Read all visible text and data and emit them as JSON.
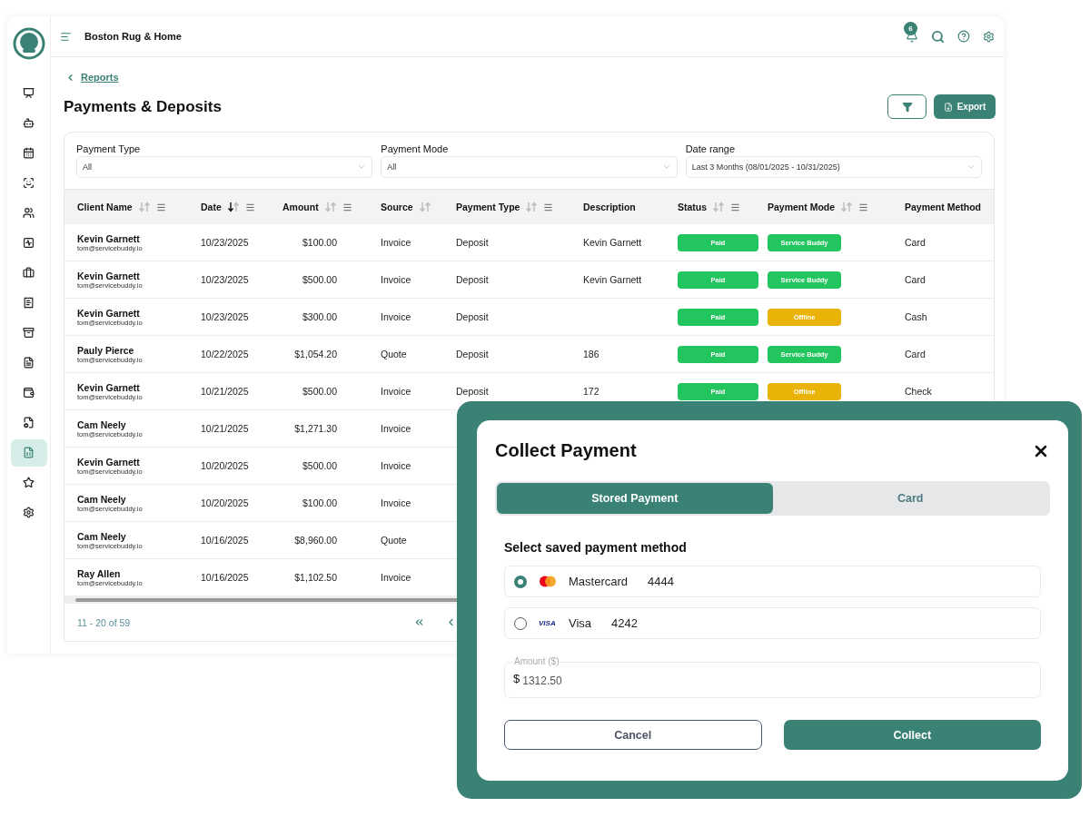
{
  "app": {
    "company": "Boston Rug & Home",
    "notifications": "6"
  },
  "sidebar": {
    "items": [
      {
        "selected": false
      },
      {
        "selected": false
      },
      {
        "selected": false
      },
      {
        "selected": false
      },
      {
        "selected": false
      },
      {
        "selected": false
      },
      {
        "selected": false
      },
      {
        "selected": false
      },
      {
        "selected": false
      },
      {
        "selected": false
      },
      {
        "selected": false
      },
      {
        "selected": false
      },
      {
        "selected": true
      },
      {
        "selected": false
      },
      {
        "selected": false
      }
    ]
  },
  "breadcrumb": "Reports",
  "page_title": "Payments & Deposits",
  "export_button": "Export",
  "filters": [
    {
      "label": "Payment Type",
      "value": "All"
    },
    {
      "label": "Payment Mode",
      "value": "All"
    },
    {
      "label": "Date range",
      "value": "Last 3 Months (08/01/2025 - 10/31/2025)"
    }
  ],
  "table": {
    "columns": [
      {
        "label": "Client Name",
        "sortable": true,
        "descending": false,
        "menu": true
      },
      {
        "label": "Date",
        "sortable": true,
        "descending": true,
        "menu": true
      },
      {
        "label": "Amount",
        "sortable": true,
        "descending": false,
        "menu": true
      },
      {
        "label": "Source",
        "sortable": true,
        "descending": false
      },
      {
        "label": "Payment Type",
        "sortable": true,
        "descending": false,
        "menu": true
      },
      {
        "label": "Description"
      },
      {
        "label": "Status",
        "sortable": true,
        "descending": false,
        "menu": true
      },
      {
        "label": "Payment Mode",
        "sortable": true,
        "descending": false,
        "menu": true
      },
      {
        "label": "Payment Method"
      }
    ],
    "rows": [
      {
        "client": "Kevin Garnett",
        "email": "tom@servicebuddy.io",
        "date": "10/23/2025",
        "amount": "$100.00",
        "source": "Invoice",
        "payment_type": "Deposit",
        "description": "Kevin Garnett",
        "status": {
          "label": "Paid",
          "color": "#22c55e"
        },
        "mode": {
          "label": "Service Buddy",
          "color": "#22c55e"
        },
        "method": "Card"
      },
      {
        "client": "Kevin Garnett",
        "email": "tom@servicebuddy.io",
        "date": "10/23/2025",
        "amount": "$500.00",
        "source": "Invoice",
        "payment_type": "Deposit",
        "description": "Kevin Garnett",
        "status": {
          "label": "Paid",
          "color": "#22c55e"
        },
        "mode": {
          "label": "Service Buddy",
          "color": "#22c55e"
        },
        "method": "Card"
      },
      {
        "client": "Kevin Garnett",
        "email": "tom@servicebuddy.io",
        "date": "10/23/2025",
        "amount": "$300.00",
        "source": "Invoice",
        "payment_type": "Deposit",
        "status": {
          "label": "Paid",
          "color": "#22c55e"
        },
        "mode": {
          "label": "Offline",
          "color": "#eab308"
        },
        "method": "Cash"
      },
      {
        "client": "Pauly Pierce",
        "email": "tom@servicebuddy.io",
        "date": "10/22/2025",
        "amount": "$1,054.20",
        "source": "Quote",
        "payment_type": "Deposit",
        "description": "186",
        "status": {
          "label": "Paid",
          "color": "#22c55e"
        },
        "mode": {
          "label": "Service Buddy",
          "color": "#22c55e"
        },
        "method": "Card"
      },
      {
        "client": "Kevin Garnett",
        "email": "tom@servicebuddy.io",
        "date": "10/21/2025",
        "amount": "$500.00",
        "source": "Invoice",
        "payment_type": "Deposit",
        "description": "172",
        "status": {
          "label": "Paid",
          "color": "#22c55e"
        },
        "mode": {
          "label": "Offline",
          "color": "#eab308"
        },
        "method": "Check"
      },
      {
        "client": "Cam Neely",
        "email": "tom@servicebuddy.io",
        "date": "10/21/2025",
        "amount": "$1,271.30",
        "source": "Invoice"
      },
      {
        "client": "Kevin Garnett",
        "email": "tom@servicebuddy.io",
        "date": "10/20/2025",
        "amount": "$500.00",
        "source": "Invoice"
      },
      {
        "client": "Cam Neely",
        "email": "tom@servicebuddy.io",
        "date": "10/20/2025",
        "amount": "$100.00",
        "source": "Invoice"
      },
      {
        "client": "Cam Neely",
        "email": "tom@servicebuddy.io",
        "date": "10/16/2025",
        "amount": "$8,960.00",
        "source": "Quote"
      },
      {
        "client": "Ray Allen",
        "email": "tom@servicebuddy.io",
        "date": "10/16/2025",
        "amount": "$1,102.50",
        "source": "Invoice"
      }
    ]
  },
  "pagination": {
    "range": "11 - 20 of 59"
  },
  "modal": {
    "title": "Collect Payment",
    "tabs": [
      {
        "label": "Stored Payment",
        "selected": true
      },
      {
        "label": "Card",
        "selected": false
      }
    ],
    "section_label": "Select saved payment method",
    "methods": [
      {
        "kind": "mastercard",
        "brand": "Mastercard",
        "last4": "4444",
        "selected": true
      },
      {
        "kind": "visa",
        "logo": "VISA",
        "brand": "Visa",
        "last4": "4242",
        "selected": false
      }
    ],
    "amount": {
      "label": "Amount ($)",
      "prefix": "$",
      "value": "1312.50"
    },
    "buttons": [
      "Cancel",
      "Collect"
    ]
  }
}
